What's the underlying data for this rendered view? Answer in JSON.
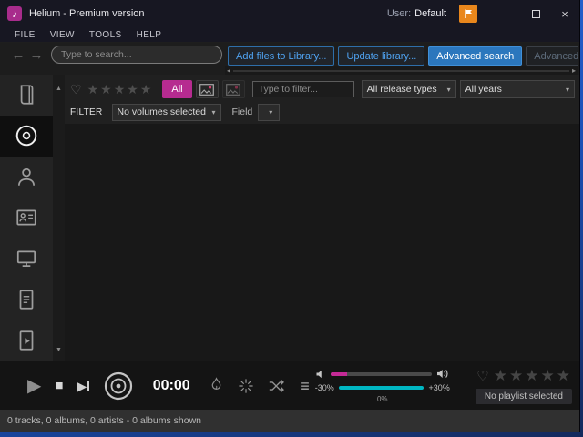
{
  "titlebar": {
    "title": "Helium - Premium version",
    "user_label": "User:",
    "user_value": "Default"
  },
  "menubar": {
    "items": [
      {
        "label": "FILE"
      },
      {
        "label": "VIEW"
      },
      {
        "label": "TOOLS"
      },
      {
        "label": "HELP"
      }
    ]
  },
  "toolbar": {
    "search_placeholder": "Type to search...",
    "buttons": {
      "add_files": "Add files to Library...",
      "update_library": "Update library...",
      "advanced_search": "Advanced search",
      "advanced_tag": "Advanced tag edito..."
    }
  },
  "filterbar": {
    "all_button": "All",
    "filter_placeholder": "Type to filter...",
    "release_types": "All release types",
    "years": "All years",
    "filter_label": "FILTER",
    "volumes": "No volumes selected",
    "field_label": "Field"
  },
  "player": {
    "time": "00:00",
    "pitch_min": "-30%",
    "pitch_max": "+30%",
    "pitch_value": "0%",
    "playlist_status": "No playlist selected"
  },
  "statusbar": {
    "text": "0 tracks, 0 albums, 0 artists - 0 albums shown"
  },
  "icons": {
    "star": "★",
    "heart": "♡",
    "back": "←",
    "forward": "→",
    "minimize": "–",
    "close": "×",
    "note": "♪",
    "up": "▲",
    "down": "▼",
    "left": "◂",
    "right": "▸",
    "caret": "▾",
    "play": "▶",
    "stop": "■",
    "menu": "≡"
  },
  "colors": {
    "accent_magenta": "#b62b90",
    "accent_cyan": "#00b7c3",
    "accent_blue": "#2b77bd"
  }
}
